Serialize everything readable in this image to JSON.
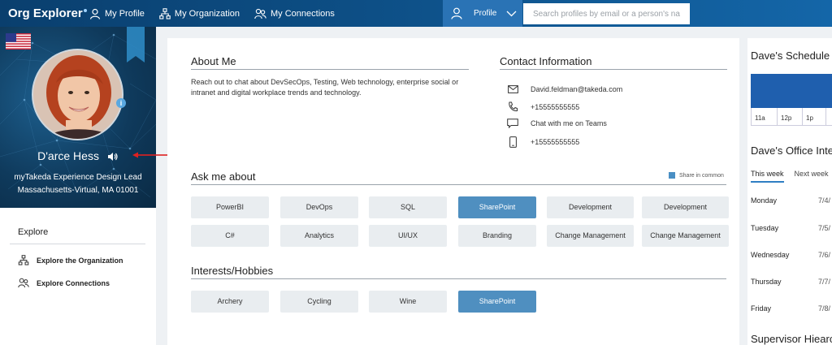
{
  "app": {
    "title": "Org Explorer"
  },
  "nav": {
    "my_profile": "My Profile",
    "my_organization": "My Organization",
    "my_connections": "My Connections",
    "profile": "Profile",
    "search_placeholder": "Search profiles by email or a person's name"
  },
  "person": {
    "name": "D'arce Hess",
    "role": "myTakeda Experience Design Lead",
    "location": "Massachusetts-Virtual, MA 01001"
  },
  "explore": {
    "title": "Explore",
    "items": [
      "Explore the Organization",
      "Explore Connections"
    ]
  },
  "about": {
    "title": "About Me",
    "text": "Reach out to chat about DevSecOps, Testing, Web technology, enterprise social or intranet and digital workplace trends and technology."
  },
  "contact": {
    "title": "Contact Information",
    "email": "David.feldman@takeda.com",
    "phone": "+15555555555",
    "teams": "Chat with me on Teams",
    "mobile": "+15555555555"
  },
  "ask": {
    "title": "Ask me about",
    "legend": "Share in common",
    "row1": [
      "PowerBI",
      "DevOps",
      "SQL",
      "SharePoint",
      "Development",
      "Development"
    ],
    "row2": [
      "C#",
      "Analytics",
      "UI/UX",
      "Branding",
      "Change Management",
      "Change Management"
    ]
  },
  "interests": {
    "title": "Interests/Hobbies",
    "items": [
      "Archery",
      "Cycling",
      "Wine",
      "SharePoint"
    ]
  },
  "schedule": {
    "title": "Dave's Schedule",
    "ticks": [
      "11a",
      "12p",
      "1p"
    ]
  },
  "office": {
    "title": "Dave's Office Inte",
    "tabs": [
      "This week",
      "Next week"
    ],
    "days": [
      {
        "day": "Monday",
        "date": "7/4/"
      },
      {
        "day": "Tuesday",
        "date": "7/5/"
      },
      {
        "day": "Wednesday",
        "date": "7/6/"
      },
      {
        "day": "Thursday",
        "date": "7/7/"
      },
      {
        "day": "Friday",
        "date": "7/8/"
      }
    ]
  },
  "supervisor": {
    "title": "Supervisor Hiearc"
  },
  "colors": {
    "nav": "#0d4f86",
    "accent": "#4f8fc0",
    "schedule": "#1f5fae",
    "arrow": "#e02020"
  }
}
